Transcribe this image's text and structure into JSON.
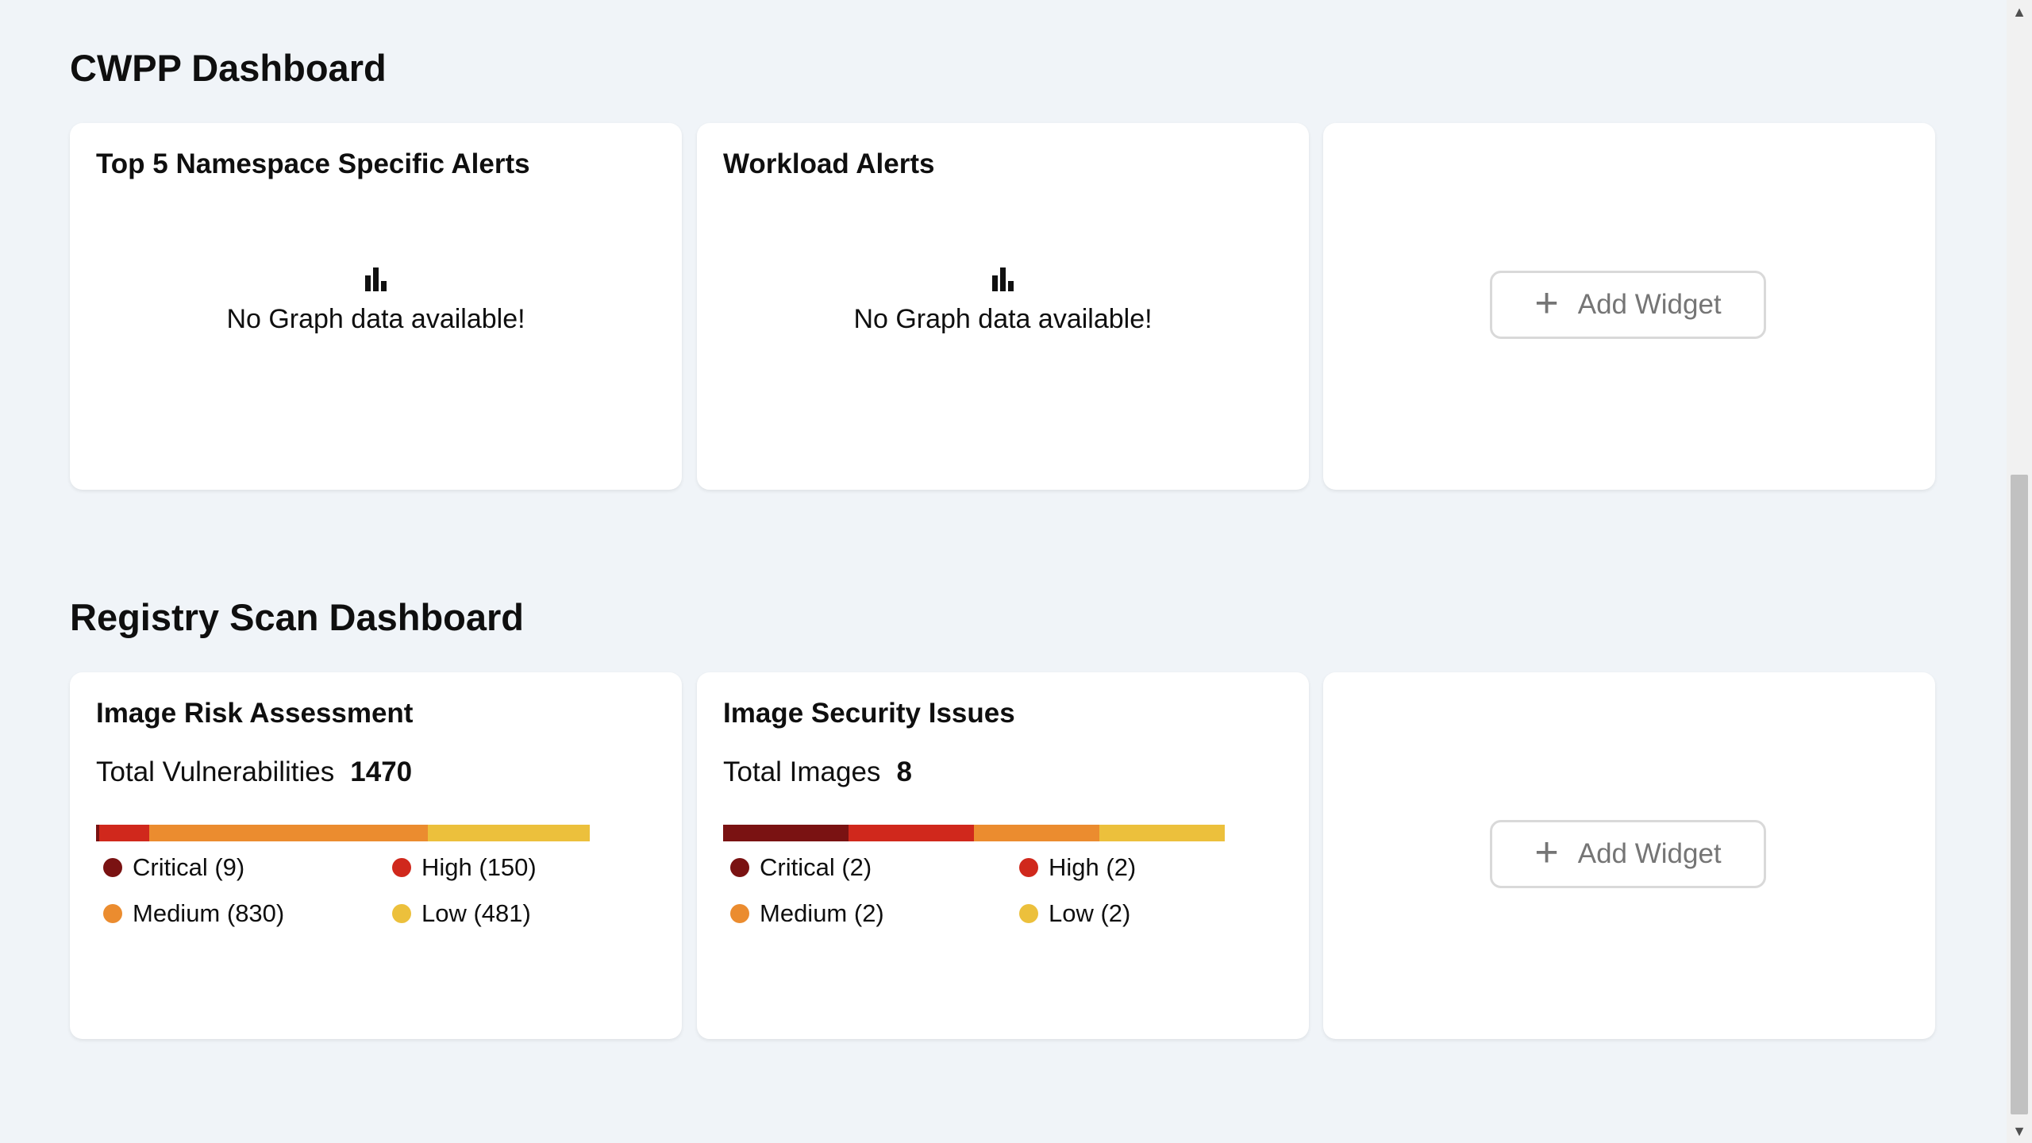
{
  "sections": [
    {
      "title": "CWPP Dashboard",
      "widgets": [
        {
          "title": "Top 5 Namespace Specific Alerts",
          "empty_text": "No Graph data available!"
        },
        {
          "title": "Workload Alerts",
          "empty_text": "No Graph data available!"
        }
      ],
      "add_widget_label": "Add Widget"
    },
    {
      "title": "Registry Scan Dashboard",
      "widgets": [
        {
          "title": "Image Risk Assessment",
          "total_label": "Total Vulnerabilities",
          "total_value": "1470",
          "segments": [
            {
              "key": "critical",
              "label": "Critical (9)",
              "value": 9,
              "color": "#7a1212"
            },
            {
              "key": "high",
              "label": "High (150)",
              "value": 150,
              "color": "#d0281c"
            },
            {
              "key": "medium",
              "label": "Medium (830)",
              "value": 830,
              "color": "#eb8c2f"
            },
            {
              "key": "low",
              "label": "Low (481)",
              "value": 481,
              "color": "#ecc03c"
            }
          ]
        },
        {
          "title": "Image Security Issues",
          "total_label": "Total Images",
          "total_value": "8",
          "segments": [
            {
              "key": "critical",
              "label": "Critical (2)",
              "value": 2,
              "color": "#7a1212"
            },
            {
              "key": "high",
              "label": "High (2)",
              "value": 2,
              "color": "#d0281c"
            },
            {
              "key": "medium",
              "label": "Medium (2)",
              "value": 2,
              "color": "#eb8c2f"
            },
            {
              "key": "low",
              "label": "Low (2)",
              "value": 2,
              "color": "#ecc03c"
            }
          ]
        }
      ],
      "add_widget_label": "Add Widget"
    }
  ],
  "icons": {
    "empty_state": "bar-chart-icon",
    "add": "plus-icon",
    "scroll_up": "chevron-up-icon",
    "scroll_down": "chevron-down-icon"
  },
  "scroll_arrows": {
    "up": "▲",
    "down": "▼"
  }
}
